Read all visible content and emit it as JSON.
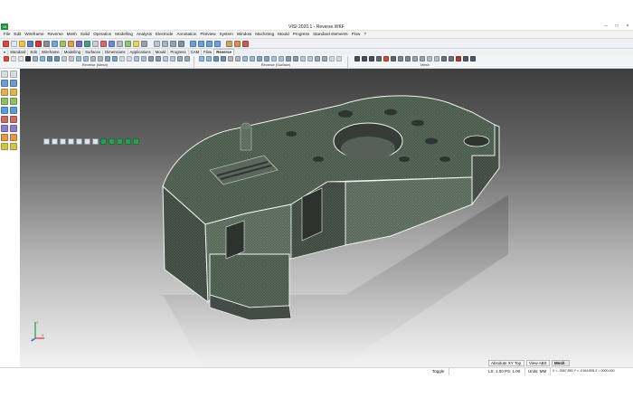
{
  "window": {
    "title": "VISI 2020.1 - Reverse.WKF",
    "logo_text": "VI",
    "controls": [
      "–",
      "□",
      "×"
    ]
  },
  "menu": {
    "items": [
      "File",
      "Edit",
      "Wireframe",
      "Reverse",
      "Mesh",
      "Solid",
      "Operation",
      "Modelling",
      "Analysis",
      "Electrode",
      "Annotation",
      "Plotview",
      "System",
      "Window",
      "Machining",
      "Mould",
      "Progress",
      "Standard elements",
      "Flow",
      "?"
    ]
  },
  "tabs": {
    "menu_glyph": "▾",
    "items": [
      "Standard",
      "Edit",
      "Wireframe",
      "Modelling",
      "Surfaces",
      "Dimensions",
      "Applications",
      "Mould",
      "Progress",
      "CAM",
      "Flow",
      "Reverse"
    ],
    "active": "Reverse"
  },
  "ribbon": {
    "groups": [
      "Reverse (Mesh)",
      "Reverse (Surface)",
      "Mesh"
    ]
  },
  "viewport": {
    "axes": {
      "x": "X",
      "y": "Y",
      "z": "Z"
    }
  },
  "view_info": {
    "view": "Absolute XY Top",
    "view_abs": "View ABS",
    "mode": "Mesh"
  },
  "status": {
    "toggle": "Toggle",
    "ls_ps": "LS: 1.00 PS: 1.00",
    "units": "Units: MM",
    "coords": "X = -0067.850 Y = -0164.805 Z = 0000.000"
  },
  "colors": {
    "mesh_surface": "#4b5a4e",
    "mesh_edge": "#f2f2f2",
    "app_logo": "#1f8f3a"
  }
}
